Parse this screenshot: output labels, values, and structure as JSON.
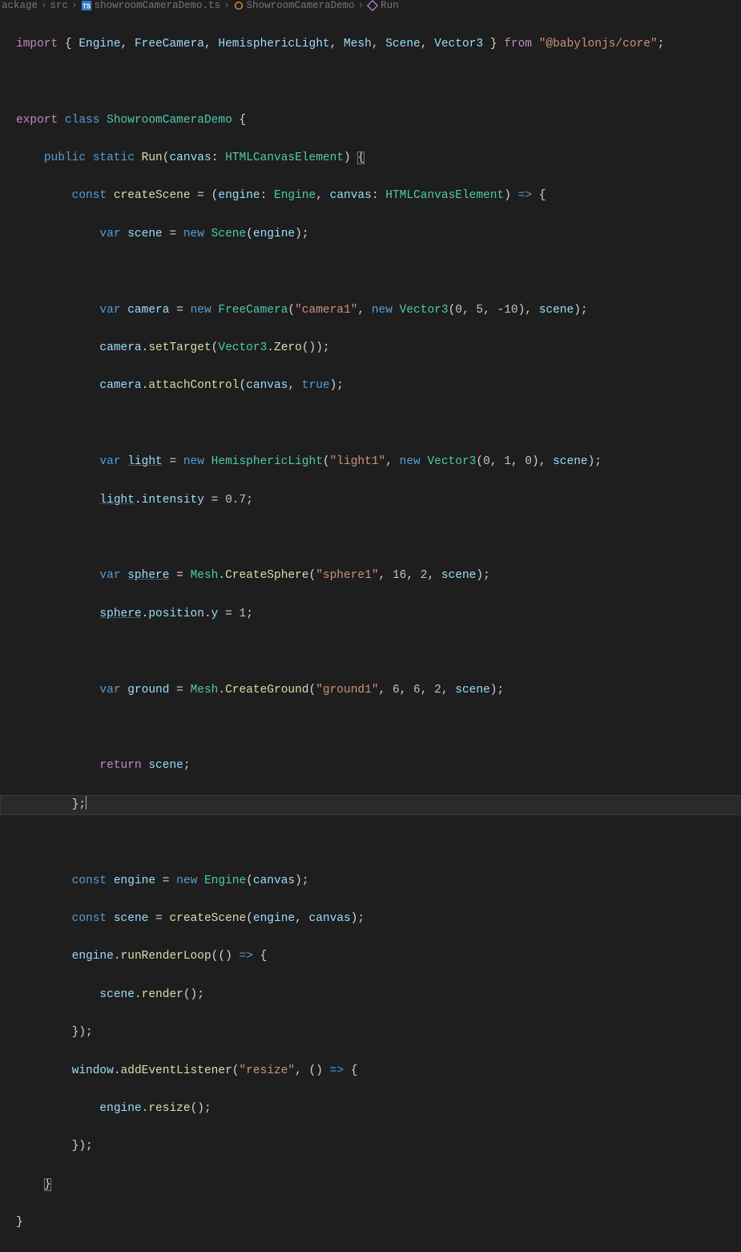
{
  "breadcrumb": {
    "parts": [
      "ackage",
      "src",
      "showroomCameraDemo.ts",
      "ShowroomCameraDemo",
      "Run"
    ]
  },
  "code": {
    "l1_a": "import",
    "l1_b": " { ",
    "l1_c": "Engine",
    "l1_d": ", ",
    "l1_e": "FreeCamera",
    "l1_f": ", ",
    "l1_g": "HemisphericLight",
    "l1_h": ", ",
    "l1_i": "Mesh",
    "l1_j": ", ",
    "l1_k": "Scene",
    "l1_l": ", ",
    "l1_m": "Vector3",
    "l1_n": " } ",
    "l1_o": "from",
    "l1_p": " ",
    "l1_q": "\"@babylonjs/core\"",
    "l1_r": ";",
    "l3_a": "export",
    "l3_b": " ",
    "l3_c": "class",
    "l3_d": " ",
    "l3_e": "ShowroomCameraDemo",
    "l3_f": " {",
    "l4_a": "    ",
    "l4_b": "public",
    "l4_c": " ",
    "l4_d": "static",
    "l4_e": " ",
    "l4_f": "Run",
    "l4_g": "(",
    "l4_h": "canvas",
    "l4_i": ": ",
    "l4_j": "HTMLCanvasElement",
    "l4_k": ") ",
    "l4_l": "{",
    "l5_a": "        ",
    "l5_b": "const",
    "l5_c": " ",
    "l5_d": "createScene",
    "l5_e": " = (",
    "l5_f": "engine",
    "l5_g": ": ",
    "l5_h": "Engine",
    "l5_i": ", ",
    "l5_j": "canvas",
    "l5_k": ": ",
    "l5_l": "HTMLCanvasElement",
    "l5_m": ") ",
    "l5_n": "=>",
    "l5_o": " {",
    "l6_a": "            ",
    "l6_b": "var",
    "l6_c": " ",
    "l6_d": "scene",
    "l6_e": " = ",
    "l6_f": "new",
    "l6_g": " ",
    "l6_h": "Scene",
    "l6_i": "(",
    "l6_j": "engine",
    "l6_k": ");",
    "l8_a": "            ",
    "l8_b": "var",
    "l8_c": " ",
    "l8_d": "camera",
    "l8_e": " = ",
    "l8_f": "new",
    "l8_g": " ",
    "l8_h": "FreeCamera",
    "l8_i": "(",
    "l8_j": "\"camera1\"",
    "l8_k": ", ",
    "l8_l": "new",
    "l8_m": " ",
    "l8_n": "Vector3",
    "l8_o": "(",
    "l8_p": "0",
    "l8_q": ", ",
    "l8_r": "5",
    "l8_s": ", -",
    "l8_t": "10",
    "l8_u": "), ",
    "l8_v": "scene",
    "l8_w": ");",
    "l9_a": "            ",
    "l9_b": "camera",
    "l9_c": ".",
    "l9_d": "setTarget",
    "l9_e": "(",
    "l9_f": "Vector3",
    "l9_g": ".",
    "l9_h": "Zero",
    "l9_i": "());",
    "l10_a": "            ",
    "l10_b": "camera",
    "l10_c": ".",
    "l10_d": "attachControl",
    "l10_e": "(",
    "l10_f": "canvas",
    "l10_g": ", ",
    "l10_h": "true",
    "l10_i": ");",
    "l12_a": "            ",
    "l12_b": "var",
    "l12_c": " ",
    "l12_d": "light",
    "l12_e": " = ",
    "l12_f": "new",
    "l12_g": " ",
    "l12_h": "HemisphericLight",
    "l12_i": "(",
    "l12_j": "\"light1\"",
    "l12_k": ", ",
    "l12_l": "new",
    "l12_m": " ",
    "l12_n": "Vector3",
    "l12_o": "(",
    "l12_p": "0",
    "l12_q": ", ",
    "l12_r": "1",
    "l12_s": ", ",
    "l12_t": "0",
    "l12_u": "), ",
    "l12_v": "scene",
    "l12_w": ");",
    "l13_a": "            ",
    "l13_b": "light",
    "l13_c": ".",
    "l13_d": "intensity",
    "l13_e": " = ",
    "l13_f": "0.7",
    "l13_g": ";",
    "l15_a": "            ",
    "l15_b": "var",
    "l15_c": " ",
    "l15_d": "sphere",
    "l15_e": " = ",
    "l15_f": "Mesh",
    "l15_g": ".",
    "l15_h": "CreateSphere",
    "l15_i": "(",
    "l15_j": "\"sphere1\"",
    "l15_k": ", ",
    "l15_l": "16",
    "l15_m": ", ",
    "l15_n": "2",
    "l15_o": ", ",
    "l15_p": "scene",
    "l15_q": ");",
    "l16_a": "            ",
    "l16_b": "sphere",
    "l16_c": ".",
    "l16_d": "position",
    "l16_e": ".",
    "l16_f": "y",
    "l16_g": " = ",
    "l16_h": "1",
    "l16_i": ";",
    "l18_a": "            ",
    "l18_b": "var",
    "l18_c": " ",
    "l18_d": "ground",
    "l18_e": " = ",
    "l18_f": "Mesh",
    "l18_g": ".",
    "l18_h": "CreateGround",
    "l18_i": "(",
    "l18_j": "\"ground1\"",
    "l18_k": ", ",
    "l18_l": "6",
    "l18_m": ", ",
    "l18_n": "6",
    "l18_o": ", ",
    "l18_p": "2",
    "l18_q": ", ",
    "l18_r": "scene",
    "l18_s": ");",
    "l20_a": "            ",
    "l20_b": "return",
    "l20_c": " ",
    "l20_d": "scene",
    "l20_e": ";",
    "l21_a": "        };",
    "l23_a": "        ",
    "l23_b": "const",
    "l23_c": " ",
    "l23_d": "engine",
    "l23_e": " = ",
    "l23_f": "new",
    "l23_g": " ",
    "l23_h": "Engine",
    "l23_i": "(",
    "l23_j": "canvas",
    "l23_k": ");",
    "l24_a": "        ",
    "l24_b": "const",
    "l24_c": " ",
    "l24_d": "scene",
    "l24_e": " = ",
    "l24_f": "createScene",
    "l24_g": "(",
    "l24_h": "engine",
    "l24_i": ", ",
    "l24_j": "canvas",
    "l24_k": ");",
    "l25_a": "        ",
    "l25_b": "engine",
    "l25_c": ".",
    "l25_d": "runRenderLoop",
    "l25_e": "(() ",
    "l25_f": "=>",
    "l25_g": " {",
    "l26_a": "            ",
    "l26_b": "scene",
    "l26_c": ".",
    "l26_d": "render",
    "l26_e": "();",
    "l27_a": "        });",
    "l28_a": "        ",
    "l28_b": "window",
    "l28_c": ".",
    "l28_d": "addEventListener",
    "l28_e": "(",
    "l28_f": "\"resize\"",
    "l28_g": ", () ",
    "l28_h": "=>",
    "l28_i": " {",
    "l29_a": "            ",
    "l29_b": "engine",
    "l29_c": ".",
    "l29_d": "resize",
    "l29_e": "();",
    "l30_a": "        });",
    "l31_a": "    ",
    "l31_b": "}",
    "l32_a": "}"
  }
}
